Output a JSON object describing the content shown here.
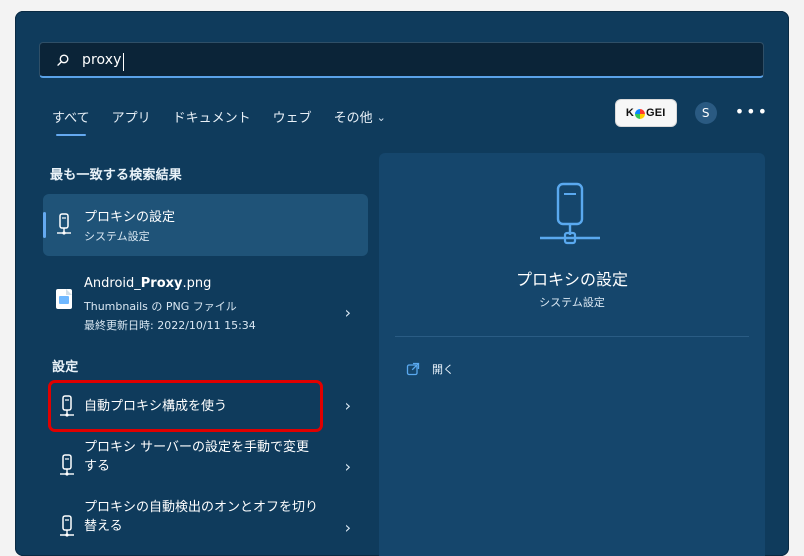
{
  "search": {
    "query": "proxy"
  },
  "tabs": [
    {
      "label": "すべて"
    },
    {
      "label": "アプリ"
    },
    {
      "label": "ドキュメント"
    },
    {
      "label": "ウェブ"
    },
    {
      "label": "その他"
    }
  ],
  "header": {
    "brand_text_left": "K",
    "brand_text_right": "GEI",
    "avatar_letter": "S",
    "more_label": "•••"
  },
  "best_match": {
    "section_title": "最も一致する検索結果",
    "title": "プロキシの設定",
    "subtitle": "システム設定"
  },
  "file_result": {
    "name_prefix": "Android_",
    "name_bold": "Proxy",
    "name_suffix": ".png",
    "line1": "Thumbnails の PNG ファイル",
    "line2": "最終更新日時: 2022/10/11 15:34"
  },
  "settings": {
    "section_title": "設定",
    "items": [
      {
        "label": "自動プロキシ構成を使う"
      },
      {
        "label": "プロキシ サーバーの設定を手動で変更する"
      },
      {
        "label": "プロキシの自動検出のオンとオフを切り替える"
      }
    ]
  },
  "preview": {
    "title": "プロキシの設定",
    "subtitle": "システム設定",
    "open_label": "開く"
  },
  "icons": {
    "search": "search-icon",
    "network": "network-proxy-icon",
    "file": "image-file-icon",
    "open": "open-external-icon",
    "chevron": "chevron-right-icon"
  },
  "colors": {
    "panel": "#0f3b5c",
    "accent": "#64a9f0",
    "highlight": "#e00000"
  }
}
